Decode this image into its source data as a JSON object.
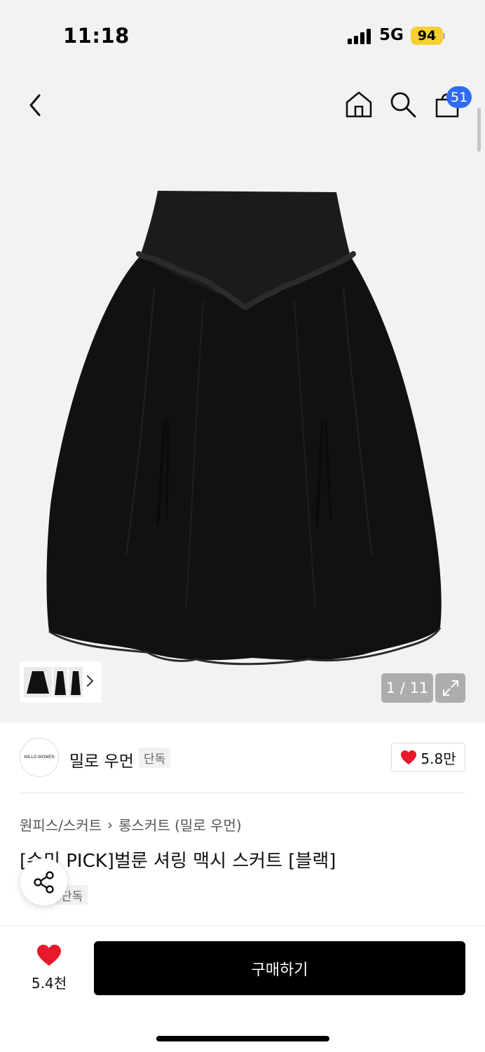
{
  "status_bar": {
    "time": "11:18",
    "network": "5G",
    "battery": "94"
  },
  "nav": {
    "back_icon": "chevron-left-icon",
    "home_icon": "home-icon",
    "search_icon": "search-icon",
    "cart_icon": "shopping-bag-icon",
    "cart_count": "51"
  },
  "gallery": {
    "counter": "1 / 11",
    "expand_icon": "expand-icon",
    "thumb_arrow_icon": "chevron-right-icon"
  },
  "brand": {
    "logo_text": "MILLO WOMEN",
    "name": "밀로 우먼",
    "tag": "단독",
    "like_count": "5.8만"
  },
  "breadcrumb": {
    "category": "원피스/스커트",
    "separator": "›",
    "subcategory": "롱스커트 (밀로 우먼)"
  },
  "product": {
    "title": "[수미 PICK]벌룬 셔링 맥시 스커트 [블랙]",
    "tag": "단독"
  },
  "bottom_bar": {
    "wish_count": "5.4천",
    "buy_label": "구매하기"
  },
  "colors": {
    "accent_blue": "#2f6cf6",
    "heart_red": "#e8192c",
    "battery_yellow": "#f6d02f",
    "buy_button": "#000000"
  }
}
